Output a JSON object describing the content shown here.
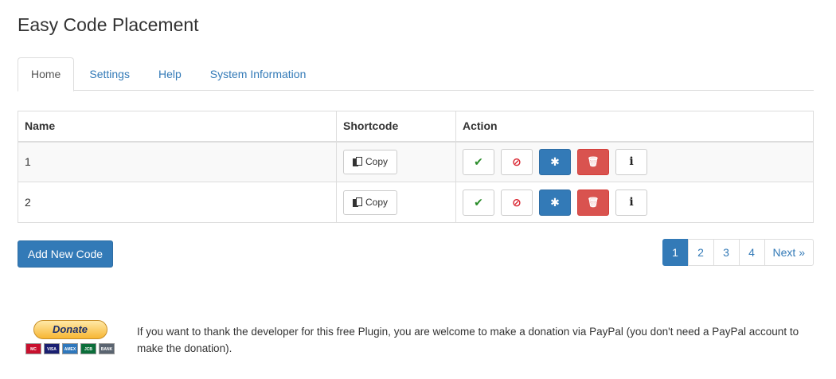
{
  "title": "Easy Code Placement",
  "tabs": [
    {
      "label": "Home"
    },
    {
      "label": "Settings"
    },
    {
      "label": "Help"
    },
    {
      "label": "System Information"
    }
  ],
  "table": {
    "headers": {
      "name": "Name",
      "shortcode": "Shortcode",
      "action": "Action"
    },
    "rows": [
      {
        "name": "1",
        "copy_label": "Copy"
      },
      {
        "name": "2",
        "copy_label": "Copy"
      }
    ],
    "actions": {
      "activate_icon": "✔",
      "deactivate_icon": "⊘",
      "settings_icon": "✱",
      "delete_icon": "🗑",
      "info_icon": "i"
    }
  },
  "add_button": "Add New Code",
  "pagination": {
    "pages": [
      "1",
      "2",
      "3",
      "4"
    ],
    "active": "1",
    "next": "Next »"
  },
  "donate": {
    "button_label": "Donate",
    "cards": [
      "MC",
      "VISA",
      "AMEX",
      "JCB",
      "BANK"
    ],
    "text": "If you want to thank the developer for this free Plugin, you are welcome to make a donation via PayPal (you don't need a PayPal account to make the donation)."
  },
  "colors": {
    "primary": "#337ab7",
    "danger": "#d9534f",
    "success_icon": "#2a8c2a",
    "ban_icon": "#d9232e",
    "row_stripe": "#f9f9f9"
  }
}
